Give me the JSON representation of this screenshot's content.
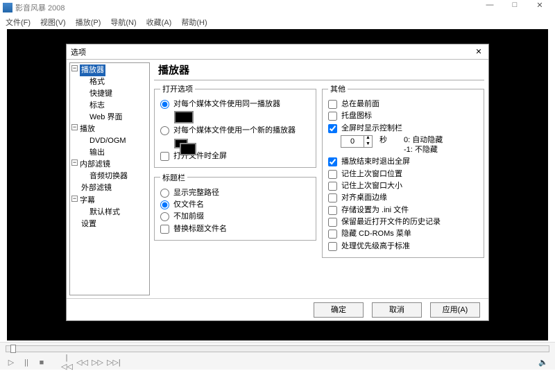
{
  "app": {
    "title": "影音风暴 2008"
  },
  "menubar": [
    "文件(F)",
    "视图(V)",
    "播放(P)",
    "导航(N)",
    "收藏(A)",
    "帮助(H)"
  ],
  "dialog": {
    "title": "选项",
    "header": "播放器",
    "tree": {
      "n0": {
        "label": "播放器",
        "expanded": true,
        "selected": true
      },
      "n0c": [
        "格式",
        "快捷键",
        "标志",
        "Web 界面"
      ],
      "n1": {
        "label": "播放",
        "expanded": true
      },
      "n1c": [
        "DVD/OGM",
        "输出"
      ],
      "n2": {
        "label": "内部滤镜",
        "expanded": true
      },
      "n2c": [
        "音频切换器"
      ],
      "n2b": "外部滤镜",
      "n3": {
        "label": "字幕",
        "expanded": true
      },
      "n3c": [
        "默认样式"
      ],
      "n4": "设置"
    },
    "open": {
      "legend": "打开选项",
      "r1": "对每个媒体文件使用同一播放器",
      "r2": "对每个媒体文件使用一个新的播放器",
      "cb": "打开文件时全屏"
    },
    "titlebar": {
      "legend": "标题栏",
      "r1": "显示完整路径",
      "r2": "仅文件名",
      "r3": "不加前缀",
      "cb": "替换标题文件名"
    },
    "other": {
      "legend": "其他",
      "c1": "总在最前面",
      "c2": "托盘图标",
      "c3": "全屏时显示控制栏",
      "spin": "0",
      "spin_unit": "秒",
      "hint1": "0: 自动隐藏",
      "hint2": "-1: 不隐藏",
      "c4": "播放结束时退出全屏",
      "c5": "记住上次窗口位置",
      "c6": "记住上次窗口大小",
      "c7": "对齐桌面边缘",
      "c8": "存储设置为 .ini 文件",
      "c9": "保留最近打开文件的历史记录",
      "c10": "隐藏 CD-ROMs 菜单",
      "c11": "处理优先级高于标准"
    },
    "buttons": {
      "ok": "确定",
      "cancel": "取消",
      "apply": "应用(A)"
    }
  },
  "player": {
    "play": "▷",
    "pause": "||",
    "stop": "■",
    "prev": "|◁◁",
    "rew": "◁◁",
    "fwd": "▷▷",
    "next": "▷▷|"
  }
}
